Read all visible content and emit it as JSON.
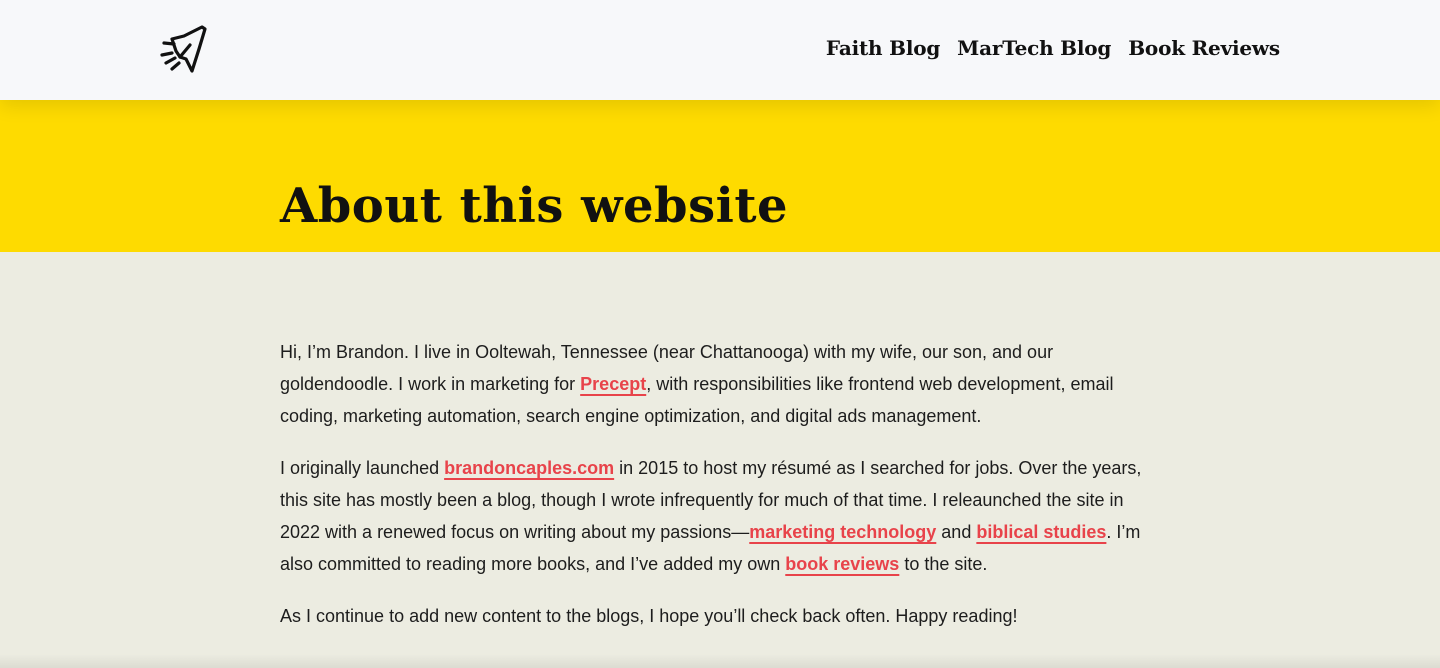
{
  "header": {
    "logo_icon": "rocket-icon",
    "nav": [
      {
        "label": "Faith Blog"
      },
      {
        "label": "MarTech Blog"
      },
      {
        "label": "Book Reviews"
      }
    ]
  },
  "hero": {
    "title": "About this website",
    "background_color": "#fedb00"
  },
  "content": {
    "p1": {
      "t1": "Hi, I’m Brandon. I live in Ooltewah, Tennessee (near Chattanooga) with my wife, our son, and our goldendoodle. I work in marketing for ",
      "link1": "Precept",
      "t2": ", with responsibilities like frontend web development, email coding, marketing automation, search engine optimization, and digital ads management."
    },
    "p2": {
      "t1": "I originally launched ",
      "link1": "brandoncaples.com",
      "t2": " in 2015 to host my résumé as I searched for jobs. Over the years, this site has mostly been a blog, though I wrote infrequently for much of that time. I releaunched the site in 2022 with a renewed focus on writing about my passions—",
      "link2": "marketing technology",
      "t3": " and ",
      "link3": "biblical studies",
      "t4": ". I’m also committed to reading more books, and I’ve added my own ",
      "link4": "book reviews",
      "t5": " to the site."
    },
    "p3": {
      "text": "As I continue to add new content to the blogs, I hope you’ll check back often. Happy reading!"
    }
  },
  "colors": {
    "link": "#e8434a",
    "page_background": "#ecece1",
    "header_background": "#f7f8fa"
  }
}
